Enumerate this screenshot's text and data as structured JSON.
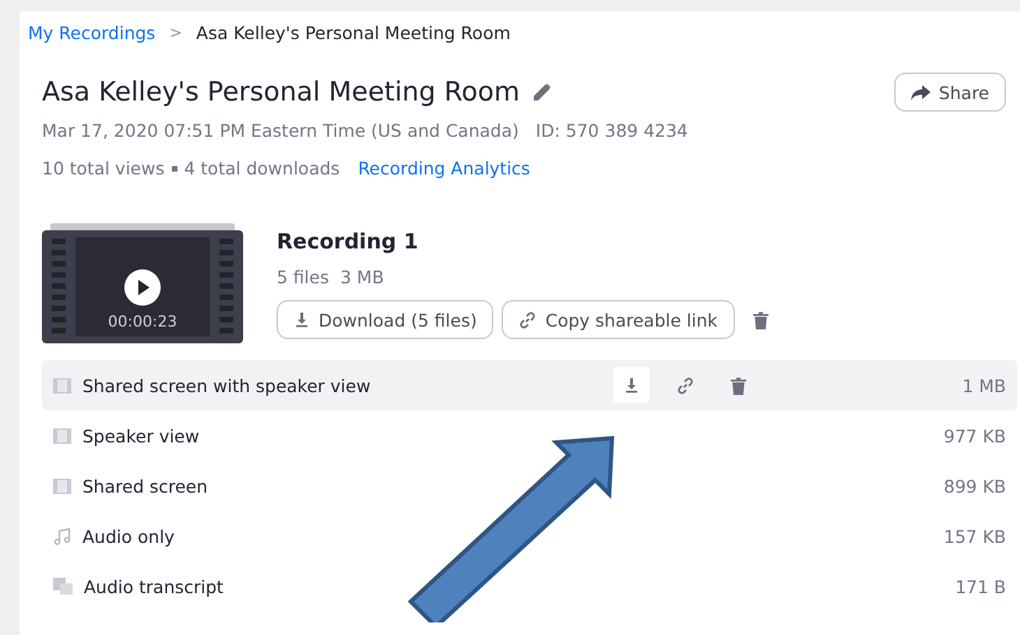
{
  "breadcrumb": {
    "link": "My Recordings",
    "separator": ">",
    "current": "Asa Kelley's Personal Meeting Room"
  },
  "meeting": {
    "title": "Asa Kelley's Personal Meeting Room",
    "date": "Mar 17, 2020 07:51 PM Eastern Time (US and Canada)",
    "id": "ID: 570 389 4234",
    "views": "10 total views",
    "downloads": "4 total downloads",
    "analytics_link": "Recording Analytics",
    "share_button": "Share"
  },
  "recording": {
    "title": "Recording 1",
    "file_count": "5 files",
    "size": "3 MB",
    "duration": "00:00:23",
    "download_button": "Download (5 files)",
    "copy_link_button": "Copy shareable link"
  },
  "files": [
    {
      "kind": "video",
      "name": "Shared screen with speaker view",
      "size": "1 MB",
      "hovered": true
    },
    {
      "kind": "video",
      "name": "Speaker view",
      "size": "977 KB",
      "hovered": false
    },
    {
      "kind": "video",
      "name": "Shared screen",
      "size": "899 KB",
      "hovered": false
    },
    {
      "kind": "audio",
      "name": "Audio only",
      "size": "157 KB",
      "hovered": false
    },
    {
      "kind": "transcript",
      "name": "Audio transcript",
      "size": "171 B",
      "hovered": false
    }
  ]
}
